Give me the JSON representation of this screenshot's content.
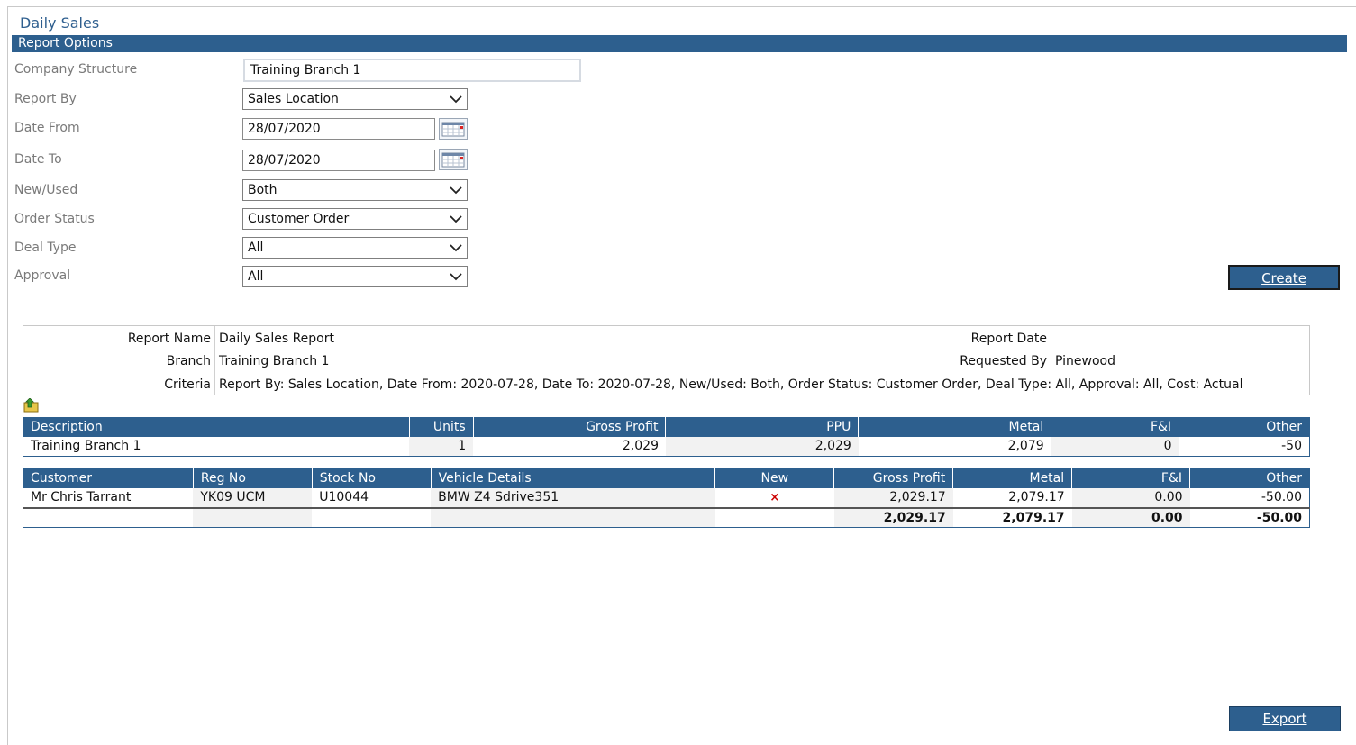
{
  "page": {
    "title": "Daily Sales",
    "section": "Report Options"
  },
  "form": {
    "company_structure": {
      "label": "Company Structure",
      "value": "Training Branch 1"
    },
    "report_by": {
      "label": "Report By",
      "value": "Sales Location"
    },
    "date_from": {
      "label": "Date From",
      "value": "28/07/2020"
    },
    "date_to": {
      "label": "Date To",
      "value": "28/07/2020"
    },
    "new_used": {
      "label": "New/Used",
      "value": "Both"
    },
    "order_status": {
      "label": "Order Status",
      "value": "Customer Order"
    },
    "deal_type": {
      "label": "Deal Type",
      "value": "All"
    },
    "approval": {
      "label": "Approval",
      "value": "All"
    },
    "create_label": "Create"
  },
  "report_info": {
    "report_name_label": "Report Name",
    "report_name": "Daily Sales Report",
    "branch_label": "Branch",
    "branch": "Training Branch 1",
    "criteria_label": "Criteria",
    "criteria": "Report By: Sales Location, Date From: 2020-07-28, Date To: 2020-07-28, New/Used: Both, Order Status: Customer Order, Deal Type: All, Approval: All, Cost: Actual",
    "report_date_label": "Report Date",
    "report_date": "",
    "requested_by_label": "Requested By",
    "requested_by": "Pinewood"
  },
  "summary": {
    "headers": [
      "Description",
      "Units",
      "Gross Profit",
      "PPU",
      "Metal",
      "F&I",
      "Other"
    ],
    "rows": [
      [
        "Training Branch 1",
        "1",
        "2,029",
        "2,029",
        "2,079",
        "0",
        "-50"
      ]
    ]
  },
  "detail": {
    "headers": [
      "Customer",
      "Reg No",
      "Stock No",
      "Vehicle Details",
      "New",
      "Gross Profit",
      "Metal",
      "F&I",
      "Other"
    ],
    "rows": [
      [
        "Mr Chris Tarrant",
        "YK09 UCM",
        "U10044",
        "BMW Z4 Sdrive351",
        "×",
        "2,029.17",
        "2,079.17",
        "0.00",
        "-50.00"
      ]
    ],
    "totals": [
      "",
      "",
      "",
      "",
      "",
      "2,029.17",
      "2,079.17",
      "0.00",
      "-50.00"
    ]
  },
  "export_label": "Export",
  "colors": {
    "accent": "#2d5f8e",
    "title": "#2f5f8f",
    "cross": "#cc0000"
  },
  "icons": {
    "dropdown": "chevron-down-icon",
    "calendar": "calendar-icon",
    "export": "export-icon",
    "new_flag": "cross-icon"
  }
}
